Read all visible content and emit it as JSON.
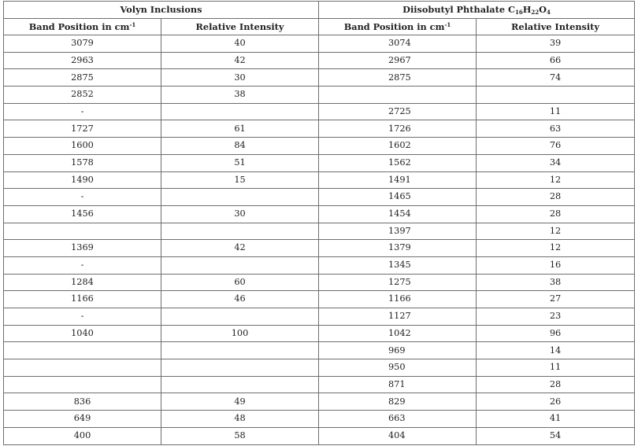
{
  "group_headers": {
    "left": "Volyn Inclusions",
    "right_prefix": "Diisobutyl Phthalate C",
    "formula_sub_c": "16",
    "formula_h": "H",
    "formula_sub_h": "22",
    "formula_o": "O",
    "formula_sub_o": "4"
  },
  "column_headers": {
    "band_position": "Band Position in cm",
    "band_unit_sup": "-1",
    "relative_intensity": "Relative Intensity"
  },
  "rows": [
    {
      "v_band": "3079",
      "v_int": "40",
      "d_band": "3074",
      "d_int": "39"
    },
    {
      "v_band": "2963",
      "v_int": "42",
      "d_band": "2967",
      "d_int": "66"
    },
    {
      "v_band": "2875",
      "v_int": "30",
      "d_band": "2875",
      "d_int": "74"
    },
    {
      "v_band": "2852",
      "v_int": "38",
      "d_band": "",
      "d_int": ""
    },
    {
      "v_band": "-",
      "v_int": "",
      "d_band": "2725",
      "d_int": "11"
    },
    {
      "v_band": "1727",
      "v_int": "61",
      "d_band": "1726",
      "d_int": "63"
    },
    {
      "v_band": "1600",
      "v_int": "84",
      "d_band": "1602",
      "d_int": "76"
    },
    {
      "v_band": "1578",
      "v_int": "51",
      "d_band": "1562",
      "d_int": "34"
    },
    {
      "v_band": "1490",
      "v_int": "15",
      "d_band": "1491",
      "d_int": "12"
    },
    {
      "v_band": "-",
      "v_int": "",
      "d_band": "1465",
      "d_int": "28"
    },
    {
      "v_band": "1456",
      "v_int": "30",
      "d_band": "1454",
      "d_int": "28"
    },
    {
      "v_band": "",
      "v_int": "",
      "d_band": "1397",
      "d_int": "12"
    },
    {
      "v_band": "1369",
      "v_int": "42",
      "d_band": "1379",
      "d_int": "12"
    },
    {
      "v_band": "-",
      "v_int": "",
      "d_band": "1345",
      "d_int": "16"
    },
    {
      "v_band": "1284",
      "v_int": "60",
      "d_band": "1275",
      "d_int": "38"
    },
    {
      "v_band": "1166",
      "v_int": "46",
      "d_band": "1166",
      "d_int": "27"
    },
    {
      "v_band": "-",
      "v_int": "",
      "d_band": "1127",
      "d_int": "23"
    },
    {
      "v_band": "1040",
      "v_int": "100",
      "d_band": "1042",
      "d_int": "96"
    },
    {
      "v_band": "",
      "v_int": "",
      "d_band": "969",
      "d_int": "14"
    },
    {
      "v_band": "",
      "v_int": "",
      "d_band": "950",
      "d_int": "11"
    },
    {
      "v_band": "",
      "v_int": "",
      "d_band": "871",
      "d_int": "28"
    },
    {
      "v_band": "836",
      "v_int": "49",
      "d_band": "829",
      "d_int": "26"
    },
    {
      "v_band": "649",
      "v_int": "48",
      "d_band": "663",
      "d_int": "41"
    },
    {
      "v_band": "400",
      "v_int": "58",
      "d_band": "404",
      "d_int": "54"
    }
  ]
}
